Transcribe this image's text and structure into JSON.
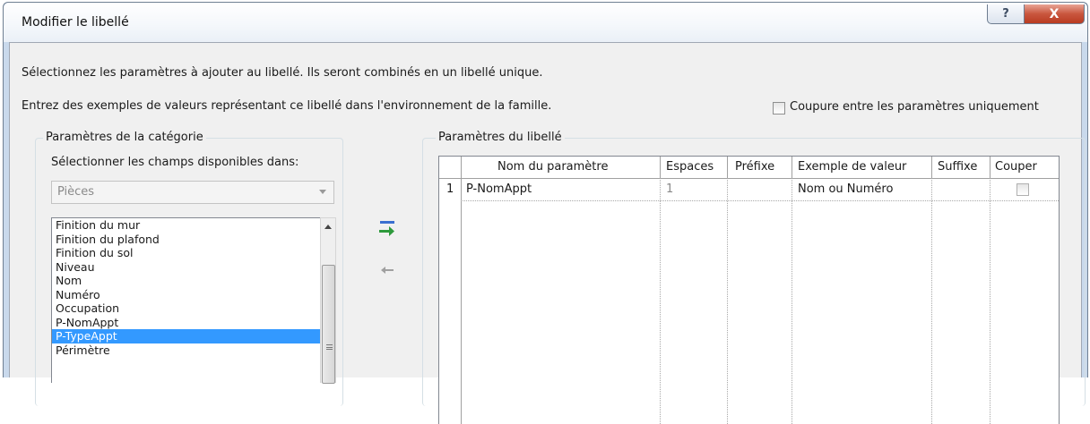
{
  "window": {
    "title": "Modifier le libellé",
    "help_label": "?",
    "close_label": "X"
  },
  "instructions": {
    "line1": "Sélectionnez les paramètres à ajouter au libellé. Ils seront combinés en un libellé unique.",
    "line2": "Entrez des exemples de valeurs représentant ce libellé dans l'environnement de la famille."
  },
  "break_option": {
    "label": "Coupure entre les paramètres uniquement",
    "checked": false
  },
  "category_panel": {
    "legend": "Paramètres de la catégorie",
    "select_label": "Sélectionner les champs disponibles dans:",
    "category_value": "Pièces",
    "fields": [
      "Finition du mur",
      "Finition du plafond",
      "Finition du sol",
      "Niveau",
      "Nom",
      "Numéro",
      "Occupation",
      "P-NomAppt",
      "P-TypeAppt",
      "Périmètre"
    ],
    "selected_field": "P-TypeAppt"
  },
  "label_panel": {
    "legend": "Paramètres du libellé",
    "columns": [
      "Nom du paramètre",
      "Espaces",
      "Préfixe",
      "Exemple de valeur",
      "Suffixe",
      "Couper"
    ],
    "rows": [
      {
        "index": "1",
        "name": "P-NomAppt",
        "spaces": "1",
        "prefix": "",
        "sample": "Nom ou Numéro",
        "suffix": "",
        "break": false
      }
    ]
  },
  "icons": {
    "add": "add-parameter-icon",
    "remove": "remove-parameter-icon"
  },
  "colors": {
    "selection": "#3399ff",
    "add_arrow": "#2e9a3c",
    "add_bar": "#3a6fd0",
    "close_button": "#c9563e"
  }
}
